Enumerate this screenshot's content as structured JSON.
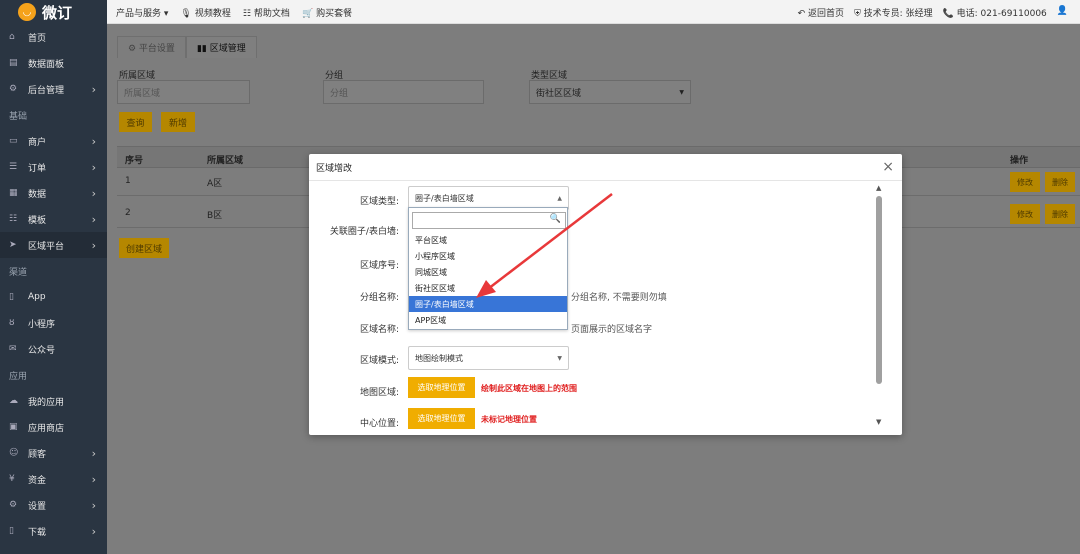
{
  "brand": {
    "logo_glyph": "◡",
    "name": "微订"
  },
  "topnav": [
    {
      "icon": "",
      "label": "产品与服务 ▾"
    },
    {
      "icon": "🎙",
      "label": "视频教程"
    },
    {
      "icon": "☷",
      "label": "帮助文档"
    },
    {
      "icon": "🛒",
      "label": "购买套餐"
    }
  ],
  "topright": {
    "back": "↶ 返回首页",
    "support": "⛨ 技术专员: 张经理",
    "phone": "📞 电话: 021-69110006",
    "avatar": "👤"
  },
  "sidebar": [
    {
      "type": "item",
      "icon": "⌂",
      "label": "首页",
      "arrow": ""
    },
    {
      "type": "item",
      "icon": "▤",
      "label": "数据面板",
      "arrow": ""
    },
    {
      "type": "item",
      "icon": "⚙",
      "label": "后台管理",
      "arrow": "›"
    },
    {
      "type": "section",
      "label": "基础"
    },
    {
      "type": "item",
      "icon": "▭",
      "label": "商户",
      "arrow": "›"
    },
    {
      "type": "item",
      "icon": "☰",
      "label": "订单",
      "arrow": "›"
    },
    {
      "type": "item",
      "icon": "▦",
      "label": "数据",
      "arrow": "›"
    },
    {
      "type": "item",
      "icon": "☷",
      "label": "模板",
      "arrow": "›"
    },
    {
      "type": "item",
      "icon": "➤",
      "label": "区域平台",
      "arrow": "›",
      "active": true
    },
    {
      "type": "section",
      "label": "渠道"
    },
    {
      "type": "item",
      "icon": "▯",
      "label": "App",
      "arrow": ""
    },
    {
      "type": "item",
      "icon": "ȣ",
      "label": "小程序",
      "arrow": ""
    },
    {
      "type": "item",
      "icon": "✉",
      "label": "公众号",
      "arrow": ""
    },
    {
      "type": "section",
      "label": "应用"
    },
    {
      "type": "item",
      "icon": "☁",
      "label": "我的应用",
      "arrow": ""
    },
    {
      "type": "item",
      "icon": "▣",
      "label": "应用商店",
      "arrow": ""
    },
    {
      "type": "item",
      "icon": "☺",
      "label": "顾客",
      "arrow": "›"
    },
    {
      "type": "item",
      "icon": "¥",
      "label": "资金",
      "arrow": "›"
    },
    {
      "type": "item",
      "icon": "⚙",
      "label": "设置",
      "arrow": "›"
    },
    {
      "type": "item",
      "icon": "▯",
      "label": "下载",
      "arrow": "›"
    }
  ],
  "tabs": [
    {
      "label": "⚙ 平台设置"
    },
    {
      "label": "▮▮ 区域管理"
    }
  ],
  "filters": {
    "area_label": "所属区域",
    "area_placeholder": "所属区域",
    "group_label": "分组",
    "group_placeholder": "分组",
    "type_label": "类型区域",
    "type_value": "街社区区域"
  },
  "buttons": {
    "search": "查询",
    "add": "新增",
    "save_area": "创建区域"
  },
  "table": {
    "headers": [
      "序号",
      "所属区域",
      "",
      "",
      "",
      "操作"
    ],
    "rows": [
      {
        "no": "1",
        "area": "A区"
      },
      {
        "no": "2",
        "area": "B区"
      }
    ],
    "row_actions": [
      "修改",
      "删除"
    ]
  },
  "modal": {
    "title": "区域增改",
    "close": "×",
    "fields": {
      "type_label": "区域类型:",
      "type_value": "圈子/表白墙区域",
      "link_label": "关联圈子/表白墙:",
      "seq_label": "区域序号:",
      "group_label": "分组名称:",
      "group_hint": "分组名称, 不需要则勿填",
      "name_label": "区域名称:",
      "name_hint": "页面展示的区域名字",
      "mode_label": "区域模式:",
      "mode_value": "地图绘制模式",
      "map_label": "地图区域:",
      "map_button": "选取地理位置",
      "map_note": "绘制此区域在地图上的范围",
      "center_label": "中心位置:",
      "center_button": "选取地理位置",
      "center_note": "未标记地理位置"
    },
    "dropdown": {
      "search_value": "",
      "options": [
        "平台区域",
        "小程序区域",
        "同城区域",
        "街社区区域",
        "圈子/表白墙区域",
        "APP区域"
      ],
      "selected_index": 4
    }
  },
  "colors": {
    "sidebar_bg": "#2a3542",
    "accent_yellow": "#f0ad00",
    "selected_blue": "#3875d7",
    "arrow_red": "#e8383a",
    "note_red": "#e02020"
  }
}
